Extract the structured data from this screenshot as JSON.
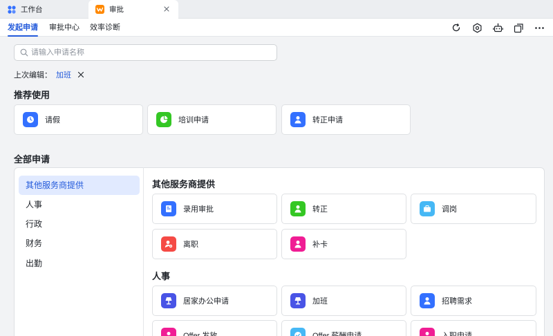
{
  "window_tabs": [
    {
      "label": "工作台",
      "icon": "workspace-icon",
      "color": "#3370ff"
    },
    {
      "label": "审批",
      "icon": "approval-icon",
      "color": "#ff8800"
    }
  ],
  "nav": {
    "tabs": [
      "发起申请",
      "审批中心",
      "效率诊断"
    ],
    "active_tab": 0,
    "actions": [
      "refresh-icon",
      "settings-icon",
      "robot-icon",
      "window-icon",
      "more-icon"
    ]
  },
  "search": {
    "placeholder": "请输入申请名称"
  },
  "last_edit": {
    "label": "上次编辑：",
    "link": "加班"
  },
  "recommended": {
    "title": "推荐使用",
    "items": [
      {
        "label": "请假",
        "icon": "clock-icon",
        "color": "#3370ff"
      },
      {
        "label": "培训申请",
        "icon": "pie-chart-icon",
        "color": "#34c724"
      },
      {
        "label": "转正申请",
        "icon": "person-icon",
        "color": "#3370ff"
      }
    ]
  },
  "all_apps": {
    "title": "全部申请",
    "categories": [
      "其他服务商提供",
      "人事",
      "行政",
      "财务",
      "出勤"
    ],
    "active_category": 0,
    "groups": [
      {
        "title": "其他服务商提供",
        "items": [
          {
            "label": "录用审批",
            "icon": "document-icon",
            "color": "#3370ff"
          },
          {
            "label": "转正",
            "icon": "person-icon",
            "color": "#34c724"
          },
          {
            "label": "调岗",
            "icon": "briefcase-icon",
            "color": "#46b8f5"
          },
          {
            "label": "离职",
            "icon": "person-remove-icon",
            "color": "#f54a45"
          },
          {
            "label": "补卡",
            "icon": "person-icon",
            "color": "#f01d94"
          }
        ]
      },
      {
        "title": "人事",
        "items": [
          {
            "label": "居家办公申请",
            "icon": "lamp-icon",
            "color": "#4954e6"
          },
          {
            "label": "加班",
            "icon": "lamp-icon",
            "color": "#4954e6"
          },
          {
            "label": "招聘需求",
            "icon": "person-icon",
            "color": "#3370ff"
          },
          {
            "label": "Offer 发放",
            "icon": "person-icon",
            "color": "#f01d94"
          },
          {
            "label": "Offer 薪酬申请",
            "icon": "check-icon",
            "color": "#46b8f5"
          },
          {
            "label": "入职申请",
            "icon": "person-icon",
            "color": "#f01d94"
          }
        ]
      }
    ]
  }
}
